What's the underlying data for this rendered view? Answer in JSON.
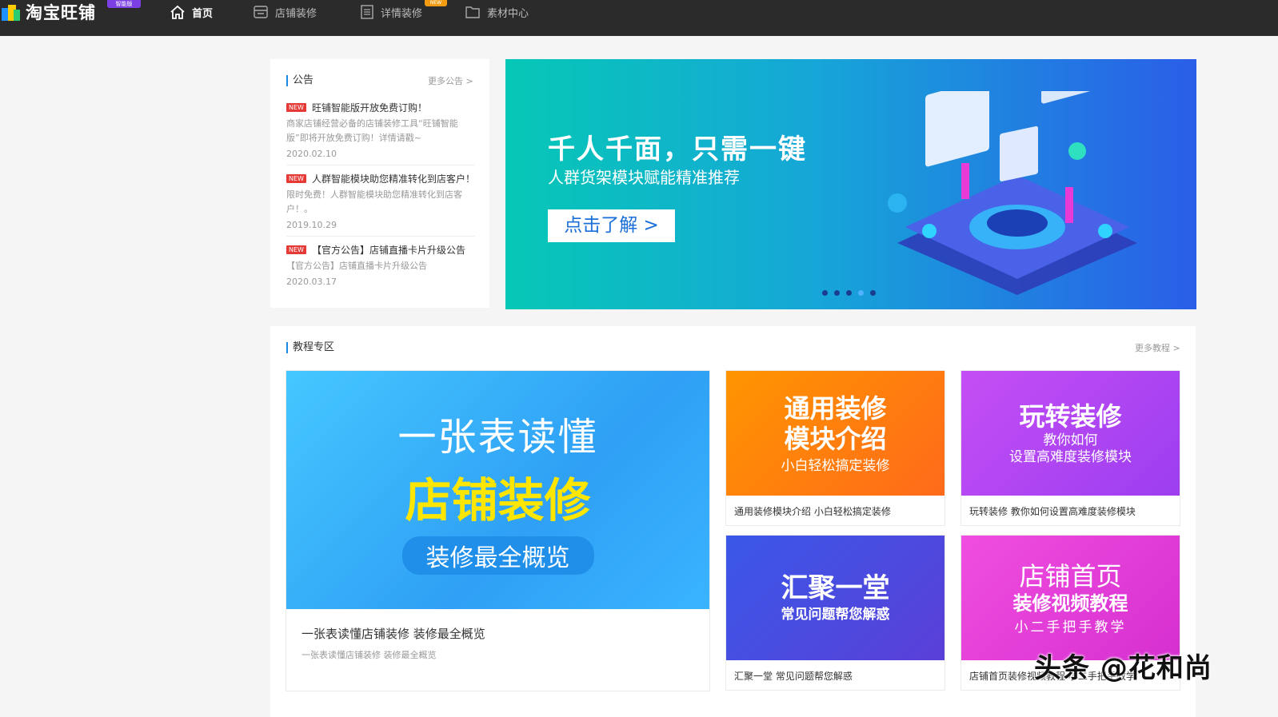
{
  "header": {
    "logo_text": "淘宝旺铺",
    "logo_badge": "智能版",
    "nav": [
      {
        "label": "首页",
        "icon": "home-icon",
        "active": true
      },
      {
        "label": "店铺装修",
        "icon": "store-icon",
        "active": false
      },
      {
        "label": "详情装修",
        "icon": "document-icon",
        "active": false
      },
      {
        "label": "素材中心",
        "icon": "folder-icon",
        "active": false
      }
    ],
    "new_badge": "NEW"
  },
  "notices": {
    "title": "公告",
    "more": "更多公告 >",
    "items": [
      {
        "tag": "NEW",
        "title": "旺铺智能版开放免费订购！",
        "desc": "商家店铺经营必备的店铺装修工具“旺铺智能版”即将开放免费订购！详情请戳~",
        "date": "2020.02.10"
      },
      {
        "tag": "NEW",
        "title": "人群智能模块助您精准转化到店客户！",
        "desc": "限时免费！人群智能模块助您精准转化到店客户！。",
        "date": "2019.10.29"
      },
      {
        "tag": "NEW",
        "title": "【官方公告】店铺直播卡片升级公告",
        "desc": "【官方公告】店铺直播卡片升级公告",
        "date": "2020.03.17"
      }
    ]
  },
  "banner": {
    "title": "千人千面，只需一键",
    "subtitle": "人群货架模块赋能精准推荐",
    "button": "点击了解 >",
    "slides": 5,
    "active_slide": 4
  },
  "tutorials": {
    "title": "教程专区",
    "more": "更多教程 >",
    "featured": {
      "img_line1": "一张表读懂",
      "img_line2": "店铺装修",
      "img_line3": "装修最全概览",
      "caption": "一张表读懂店铺装修 装修最全概览",
      "sub": "一张表读懂店铺装修 装修最全概览"
    },
    "items": [
      {
        "img_line1": "通用装修",
        "img_line2": "模块介绍",
        "img_line3": "小白轻松搞定装修",
        "caption": "通用装修模块介绍 小白轻松搞定装修",
        "color": "#ff7a12"
      },
      {
        "img_line1": "玩转装修",
        "img_line2": "教你如何",
        "img_line3": "设置高难度装修模块",
        "caption": "玩转装修 教你如何设置高难度装修模块",
        "color": "#b845f0"
      },
      {
        "img_line1": "汇聚一堂",
        "img_line2": "常见问题帮您解惑",
        "img_line3": "",
        "caption": "汇聚一堂 常见问题帮您解惑",
        "color": "#4a4fe0"
      },
      {
        "img_line1": "店铺首页",
        "img_line2": "装修视频教程",
        "img_line3": "小二手把手教学",
        "caption": "店铺首页装修视频教程 小二手把手教学",
        "color": "#e93ad8"
      }
    ]
  },
  "watermark": "头条 @花和尚"
}
